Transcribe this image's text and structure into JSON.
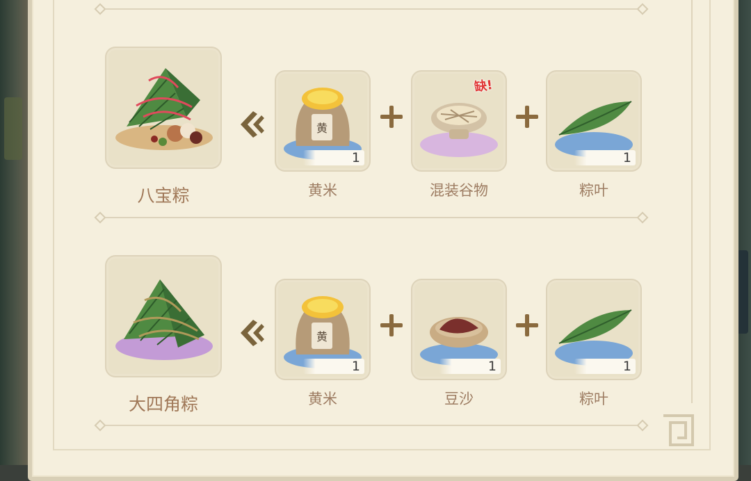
{
  "recipes": [
    {
      "result": {
        "name": "八宝粽",
        "icon": "eight-treasure-zongzi-icon"
      },
      "ingredients": [
        {
          "name": "黄米",
          "count": "1",
          "icon": "millet-sack-icon"
        },
        {
          "name": "混装谷物",
          "count": "",
          "icon": "mixed-grains-bowl-icon",
          "badge": "缺!"
        },
        {
          "name": "粽叶",
          "count": "1",
          "icon": "zongzi-leaf-icon"
        }
      ]
    },
    {
      "result": {
        "name": "大四角粽",
        "icon": "four-corner-zongzi-icon"
      },
      "ingredients": [
        {
          "name": "黄米",
          "count": "1",
          "icon": "millet-sack-icon"
        },
        {
          "name": "豆沙",
          "count": "1",
          "icon": "bean-paste-bowl-icon"
        },
        {
          "name": "粽叶",
          "count": "1",
          "icon": "zongzi-leaf-icon"
        }
      ]
    }
  ],
  "colors": {
    "panel": "#f5efdd",
    "card": "#e9e1c8",
    "label": "#9d7c62",
    "missing_badge": "#e03434",
    "connector": "#8a6a3e"
  }
}
